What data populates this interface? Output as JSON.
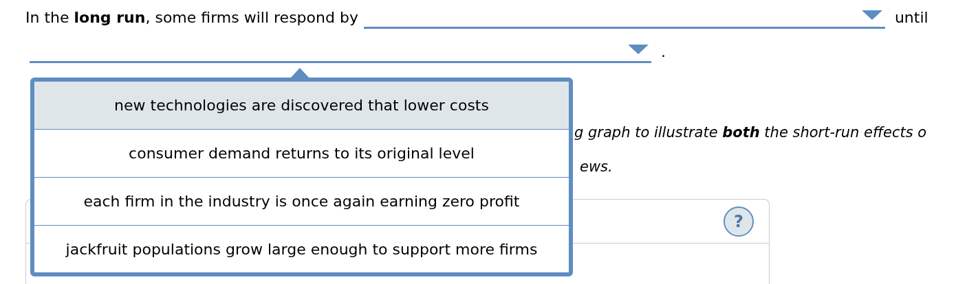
{
  "sentence": {
    "lead": "In the **long run**, some firms will respond by",
    "middle": "until",
    "end": "."
  },
  "menu": {
    "options": [
      {
        "label": "new technologies are discovered that lower costs",
        "selected": true
      },
      {
        "label": "consumer demand returns to its original level",
        "selected": false
      },
      {
        "label": "each firm in the industry is once again earning zero profit",
        "selected": false
      },
      {
        "label": "jackfruit populations grow large enough to support more firms",
        "selected": false
      }
    ]
  },
  "instructions": [
    "g graph to illustrate **both** the short-run effects o",
    "ews."
  ],
  "graph_panel": {
    "help": "?"
  }
}
